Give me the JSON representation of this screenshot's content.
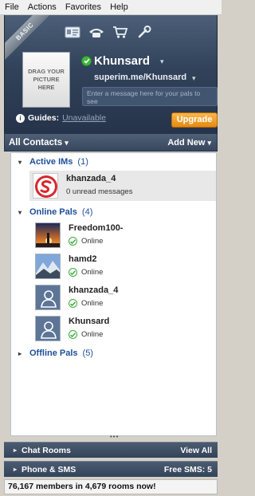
{
  "menu": [
    "File",
    "Actions",
    "Favorites",
    "Help"
  ],
  "header": {
    "badge": "BASIC",
    "toolbar_icons": [
      "contact-card-icon",
      "phone-icon",
      "cart-icon",
      "wrench-icon"
    ],
    "photo_label": "DRAG YOUR PICTURE HERE",
    "username": "Khunsard",
    "profile_url": "superim.me/Khunsard",
    "status_placeholder": "Enter a message here for your pals to see",
    "guides_label": "Guides:",
    "guides_value": "Unavailable",
    "upgrade_label": "Upgrade",
    "status_color": "#3fb83f"
  },
  "contacts_bar": {
    "title": "All Contacts",
    "add_new": "Add New"
  },
  "groups": {
    "active": {
      "label": "Active IMs",
      "count": "(1)"
    },
    "online": {
      "label": "Online Pals",
      "count": "(4)"
    },
    "offline": {
      "label": "Offline Pals",
      "count": "(5)"
    }
  },
  "active_ims": [
    {
      "name": "khanzada_4",
      "status": "0 unread messages",
      "avatar": "superim-logo-icon"
    }
  ],
  "online_pals": [
    {
      "name": "Freedom100-",
      "status": "Online",
      "avatar": "sunset-photo"
    },
    {
      "name": "hamd2",
      "status": "Online",
      "avatar": "mountain-photo"
    },
    {
      "name": "khanzada_4",
      "status": "Online",
      "avatar": "default-user-icon"
    },
    {
      "name": "Khunsard",
      "status": "Online",
      "avatar": "default-user-icon"
    }
  ],
  "bottom": {
    "chat_rooms": "Chat Rooms",
    "view_all": "View All",
    "phone_sms": "Phone & SMS",
    "free_sms": "Free SMS: 5",
    "footer": "76,167 members in 4,679 rooms now!"
  },
  "colors": {
    "accent_orange": "#e88a10",
    "header_navy": "#31425a",
    "link_blue": "#1c4f9a"
  }
}
